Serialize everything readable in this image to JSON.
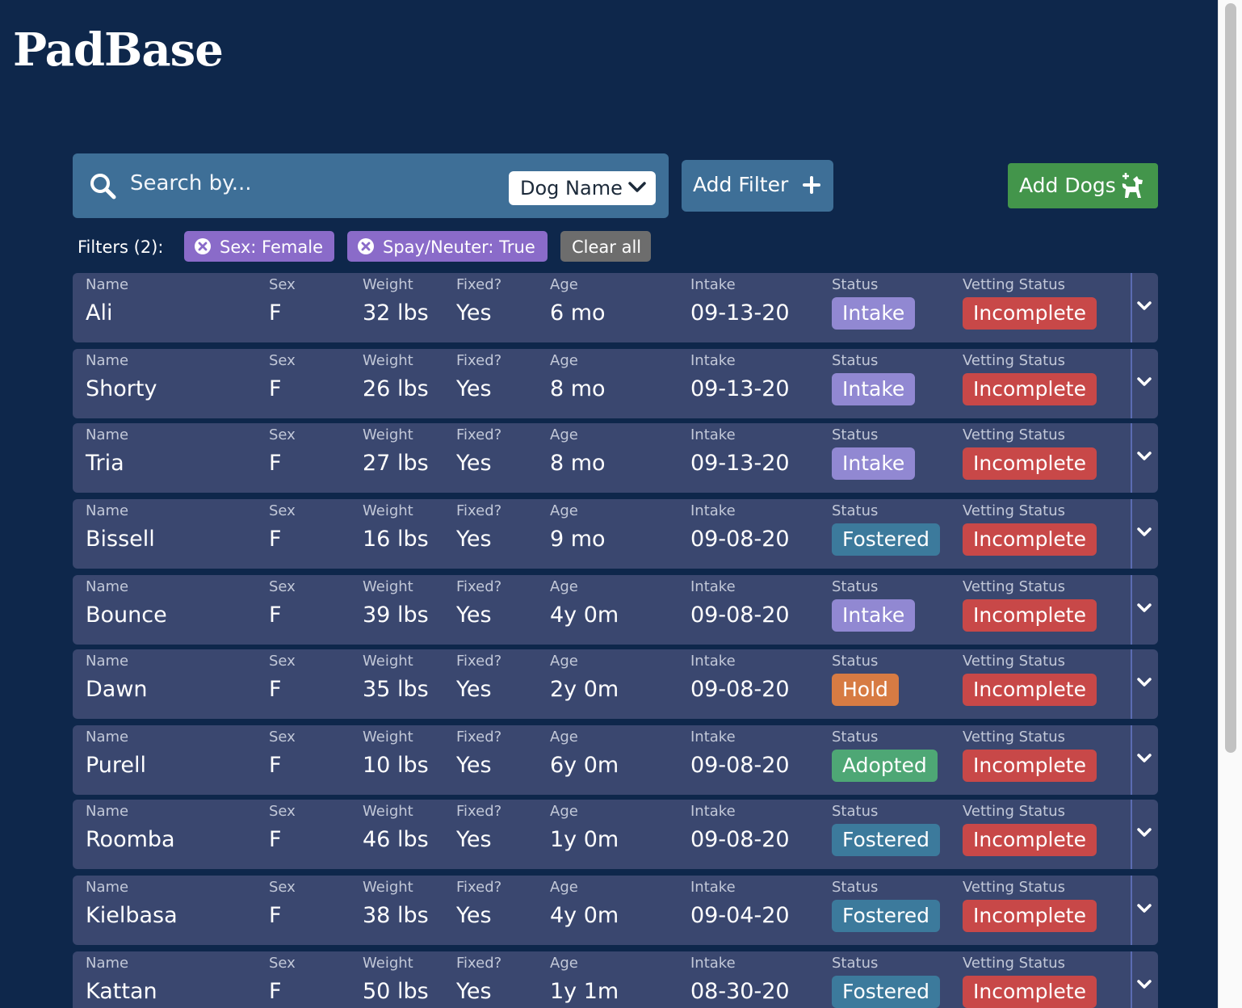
{
  "app": {
    "logo": "PadBase"
  },
  "search": {
    "placeholder": "Search by...",
    "field": "Dog Name"
  },
  "toolbar": {
    "add_filter": "Add Filter",
    "add_dogs": "Add Dogs"
  },
  "filters": {
    "label": "Filters (2):",
    "chips": [
      "Sex: Female",
      "Spay/Neuter: True"
    ],
    "clear_all": "Clear all"
  },
  "columns": {
    "name": "Name",
    "sex": "Sex",
    "weight": "Weight",
    "fixed": "Fixed?",
    "age": "Age",
    "intake": "Intake",
    "status": "Status",
    "vetting": "Vetting Status"
  },
  "dogs": [
    {
      "name": "Ali",
      "sex": "F",
      "weight": "32 lbs",
      "fixed": "Yes",
      "age": "6 mo",
      "intake": "09-13-20",
      "status": "Intake",
      "vetting": "Incomplete"
    },
    {
      "name": "Shorty",
      "sex": "F",
      "weight": "26 lbs",
      "fixed": "Yes",
      "age": "8 mo",
      "intake": "09-13-20",
      "status": "Intake",
      "vetting": "Incomplete"
    },
    {
      "name": "Tria",
      "sex": "F",
      "weight": "27 lbs",
      "fixed": "Yes",
      "age": "8 mo",
      "intake": "09-13-20",
      "status": "Intake",
      "vetting": "Incomplete"
    },
    {
      "name": "Bissell",
      "sex": "F",
      "weight": "16 lbs",
      "fixed": "Yes",
      "age": "9 mo",
      "intake": "09-08-20",
      "status": "Fostered",
      "vetting": "Incomplete"
    },
    {
      "name": "Bounce",
      "sex": "F",
      "weight": "39 lbs",
      "fixed": "Yes",
      "age": "4y 0m",
      "intake": "09-08-20",
      "status": "Intake",
      "vetting": "Incomplete"
    },
    {
      "name": "Dawn",
      "sex": "F",
      "weight": "35 lbs",
      "fixed": "Yes",
      "age": "2y 0m",
      "intake": "09-08-20",
      "status": "Hold",
      "vetting": "Incomplete"
    },
    {
      "name": "Purell",
      "sex": "F",
      "weight": "10 lbs",
      "fixed": "Yes",
      "age": "6y 0m",
      "intake": "09-08-20",
      "status": "Adopted",
      "vetting": "Incomplete"
    },
    {
      "name": "Roomba",
      "sex": "F",
      "weight": "46 lbs",
      "fixed": "Yes",
      "age": "1y 0m",
      "intake": "09-08-20",
      "status": "Fostered",
      "vetting": "Incomplete"
    },
    {
      "name": "Kielbasa",
      "sex": "F",
      "weight": "38 lbs",
      "fixed": "Yes",
      "age": "4y 0m",
      "intake": "09-04-20",
      "status": "Fostered",
      "vetting": "Incomplete"
    },
    {
      "name": "Kattan",
      "sex": "F",
      "weight": "50 lbs",
      "fixed": "Yes",
      "age": "1y 1m",
      "intake": "08-30-20",
      "status": "Fostered",
      "vetting": "Incomplete"
    }
  ],
  "colors": {
    "background": "#0e274b",
    "row": "#3a476f",
    "intake": "#9188d2",
    "fostered": "#3c7a9c",
    "hold": "#d77b43",
    "adopted": "#4ea775",
    "incomplete": "#c84848",
    "add_dogs": "#43954b",
    "filter_chip": "#8a6bc9"
  },
  "icons": {
    "search": "search-icon",
    "dropdown": "chevron-down-icon",
    "add": "plus-icon",
    "add_dog": "dog-plus-icon",
    "remove_filter": "close-circle-icon",
    "expand_row": "chevron-down-icon"
  }
}
